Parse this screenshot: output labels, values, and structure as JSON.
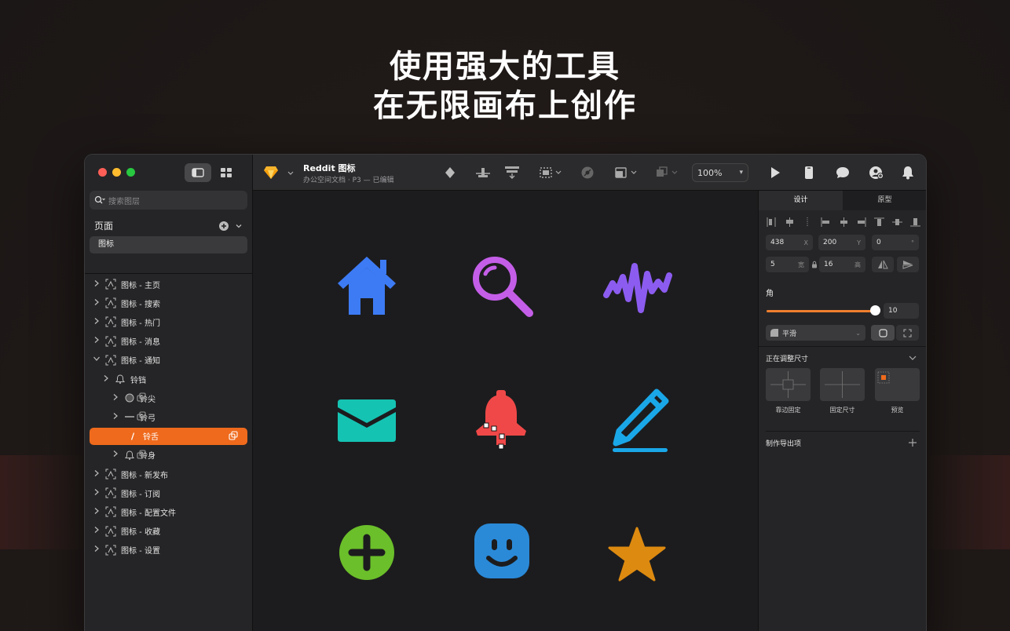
{
  "headline": {
    "line1": "使用强大的工具",
    "line2": "在无限画布上创作"
  },
  "sidebar": {
    "search_placeholder": "搜索图层",
    "pages_label": "页面",
    "pages": [
      "图标"
    ],
    "layers": [
      {
        "label": "图标 - 主页",
        "level": 0,
        "chevron": ">",
        "icon": "artboard-icon"
      },
      {
        "label": "图标 - 搜索",
        "level": 0,
        "chevron": ">",
        "icon": "artboard-icon"
      },
      {
        "label": "图标 - 热门",
        "level": 0,
        "chevron": ">",
        "icon": "artboard-icon"
      },
      {
        "label": "图标 - 消息",
        "level": 0,
        "chevron": ">",
        "icon": "artboard-icon"
      },
      {
        "label": "图标 - 通知",
        "level": 0,
        "chevron": "v",
        "icon": "artboard-icon"
      },
      {
        "label": "铃铛",
        "level": 1,
        "chevron": ">",
        "icon": "bell-icon"
      },
      {
        "label": "铃尖",
        "level": 2,
        "chevron": ">",
        "icon": "circle-icon"
      },
      {
        "label": "铃弓",
        "level": 2,
        "chevron": ">",
        "icon": "line-icon"
      },
      {
        "label": "铃舌",
        "level": 2,
        "chevron": "",
        "icon": "pen-path-icon",
        "selected": true
      },
      {
        "label": "铃身",
        "level": 2,
        "chevron": ">",
        "icon": "bell-icon"
      },
      {
        "label": "图标 - 新发布",
        "level": 0,
        "chevron": ">",
        "icon": "artboard-icon"
      },
      {
        "label": "图标 - 订阅",
        "level": 0,
        "chevron": ">",
        "icon": "artboard-icon"
      },
      {
        "label": "图标 - 配置文件",
        "level": 0,
        "chevron": ">",
        "icon": "artboard-icon"
      },
      {
        "label": "图标 - 收藏",
        "level": 0,
        "chevron": ">",
        "icon": "artboard-icon"
      },
      {
        "label": "图标 - 设置",
        "level": 0,
        "chevron": ">",
        "icon": "artboard-icon"
      }
    ]
  },
  "toolbar": {
    "doc_title": "Reddit 图标",
    "doc_subtitle": "办公空间文档 · P3 — 已编辑",
    "zoom": "100%"
  },
  "canvas": {
    "artboards": [
      "home-icon",
      "search-icon",
      "trending-icon",
      "mail-icon",
      "bell-icon",
      "pencil-icon",
      "add-icon",
      "face-icon",
      "star-icon"
    ],
    "colors": {
      "home": "#3d7bf5",
      "search": "#c45ee8",
      "trending": "#8c5cf0",
      "mail": "#15c3b3",
      "bell": "#f04848",
      "pencil": "#1aa7e8",
      "add": "#6bbf2a",
      "face": "#2a8ad8",
      "star": "#dd8a10"
    }
  },
  "inspector": {
    "tabs": [
      "设计",
      "原型"
    ],
    "x": "438",
    "x_suffix": "X",
    "y": "200",
    "y_suffix": "Y",
    "rotation": "0",
    "rotation_suffix": "°",
    "width": "5",
    "width_suffix": "宽",
    "height": "16",
    "height_suffix": "高",
    "corner_label": "角",
    "corner_value": "10",
    "corner_style": "平滑",
    "resizing_label": "正在调整尺寸",
    "resizing_options": [
      "靠边固定",
      "固定尺寸",
      "预览"
    ],
    "export_label": "制作导出项",
    "accent_color": "#ef6a1c"
  }
}
